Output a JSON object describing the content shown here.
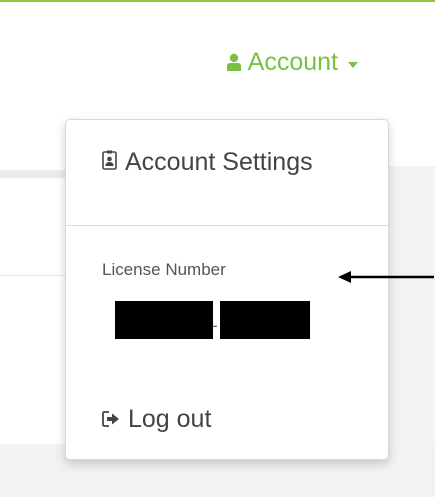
{
  "nav": {
    "account_label": "Account"
  },
  "dropdown": {
    "account_settings": "Account Settings",
    "license_label": "License Number",
    "license_separator": "-",
    "logout": "Log out"
  },
  "colors": {
    "accent": "#7ac143",
    "border": "#8cc63f"
  },
  "icons": {
    "user": "user-icon",
    "settings": "id-badge-icon",
    "logout": "sign-out-icon"
  }
}
